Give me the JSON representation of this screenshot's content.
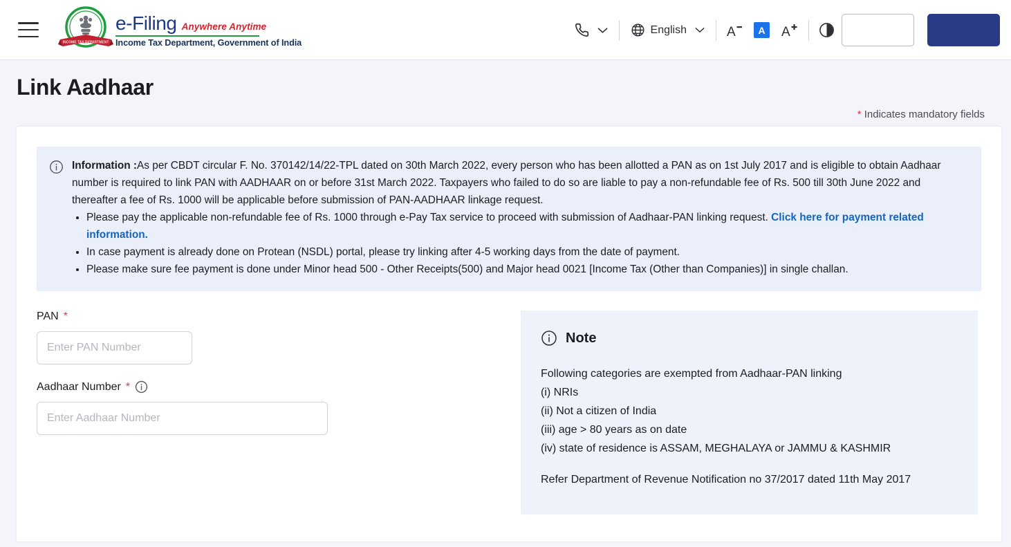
{
  "header": {
    "menu_icon": "hamburger-menu-icon",
    "logo": {
      "emblem_alt": "income-tax-department-emblem",
      "brand": "e-Filing",
      "tagline": "Anywhere Anytime",
      "department": "Income Tax Department, Government of India"
    },
    "phone": {
      "icon": "phone-icon",
      "chevron": "chevron-down-icon"
    },
    "language": {
      "icon": "globe-icon",
      "label": "English",
      "chevron": "chevron-down-icon"
    },
    "font_size": {
      "decrease": "A-",
      "normal": "A",
      "increase": "A+",
      "active": "normal"
    },
    "contrast_icon": "contrast-icon",
    "buttons": {
      "secondary_label": "",
      "primary_label": ""
    },
    "colors": {
      "brand_blue": "#1b3a8c",
      "tagline_red": "#d5232f",
      "rule_green": "#1f9e3e",
      "primary_btn": "#2b3a87",
      "accent_blue": "#1a73e8"
    }
  },
  "page": {
    "title": "Link Aadhaar",
    "mandatory_note_symbol": "*",
    "mandatory_note": "Indicates mandatory fields"
  },
  "info_banner": {
    "icon": "info-circle-icon",
    "label": "Information :",
    "paragraph": "As per CBDT circular F. No. 370142/14/22-TPL dated on 30th March 2022, every person who has been allotted a PAN as on 1st July 2017 and is eligible to obtain Aadhaar number is required to link PAN with AADHAAR on or before 31st March 2022. Taxpayers who failed to do so are liable to pay a non-refundable fee of Rs. 500 till 30th June 2022 and thereafter a fee of Rs. 1000 will be applicable before submission of PAN-AADHAAR linkage request.",
    "bullet_1_before": "Please pay the applicable non-refundable fee of Rs. 1000 through e-Pay Tax service to proceed with submission of Aadhaar-PAN linking request. Click here for payment related information. ",
    "bullet_1_link": "Click here for payment related information.",
    "bullet_2": "In case payment is already done on Protean (NSDL) portal, please try linking after 4-5 working days from the date of payment.",
    "bullet_3": "Please make sure fee payment is done under Minor head 500 - Other Receipts(500) and Major head 0021 [Income Tax (Other than Companies)] in single challan."
  },
  "form": {
    "pan": {
      "label": "PAN",
      "required_mark": "*",
      "value": "",
      "placeholder": "Enter PAN Number"
    },
    "aadhaar": {
      "label": "Aadhaar Number",
      "required_mark": "*",
      "info_icon": "info-circle-icon",
      "value": "",
      "placeholder": "Enter Aadhaar Number"
    }
  },
  "note": {
    "icon": "info-circle-icon",
    "title": "Note",
    "intro": "Following categories are exempted from Aadhaar-PAN linking",
    "items": [
      "(i) NRIs",
      "(ii) Not a citizen of India",
      "(iii) age > 80 years as on date",
      "(iv) state of residence is ASSAM, MEGHALAYA or JAMMU & KASHMIR"
    ],
    "reference": "Refer Department of Revenue Notification no 37/2017 dated 11th May 2017"
  }
}
